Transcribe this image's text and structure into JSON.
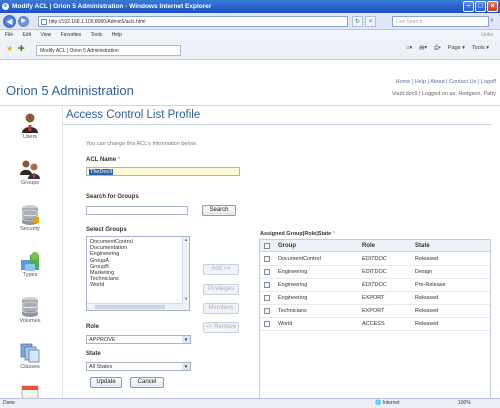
{
  "browser": {
    "title": "Modify ACL | Orion 5 Administration - Windows Internet Explorer",
    "address": "http://192.168.1.105:8080/Admin5/acls.html",
    "search_placeholder": "Live Search",
    "menu": [
      "File",
      "Edit",
      "View",
      "Favorites",
      "Tools",
      "Help"
    ],
    "links_label": "Links",
    "tab_label": "Modify ACL | Orion 5 Administration",
    "tools": [
      "Page ▾",
      "Tools ▾"
    ],
    "status_done": "Done",
    "status_zone": "Internet",
    "status_zoom": "100%"
  },
  "header": {
    "app_title": "Orion 5 Administration",
    "top_links": "Home | Help | About | Contact Us | Logoff",
    "vault_line": "Vault:doc9  |  Logged on as: Hodgson, Patty"
  },
  "sidebar": {
    "items": [
      {
        "label": "Users",
        "icon": "user-icon"
      },
      {
        "label": "Groups",
        "icon": "group-icon"
      },
      {
        "label": "Security",
        "icon": "database-lock-icon"
      },
      {
        "label": "Types",
        "icon": "types-icon"
      },
      {
        "label": "Volumes",
        "icon": "volumes-icon"
      },
      {
        "label": "Classes",
        "icon": "classes-icon"
      }
    ]
  },
  "form": {
    "page_title": "Access Control List Profile",
    "intro": "You can change this ACL's information below.",
    "acl_name_label": "ACL Name",
    "required_mark": "*",
    "acl_name_value": "TheDoc9",
    "search_groups_label": "Search for Groups",
    "search_groups_value": "",
    "search_button": "Search",
    "select_groups_label": "Select Groups",
    "groups": [
      "DocumentControl",
      "Documentation",
      "Engineering",
      "GroupA",
      "GroupB",
      "Marketing",
      "Technicians",
      "World"
    ],
    "add_button": "Add >>",
    "privileges_button": "Privileges",
    "members_button": "Members",
    "remove_button": "<< Remove",
    "role_label": "Role",
    "role_value": "APPROVE",
    "state_label": "State",
    "state_value": "All States",
    "update_button": "Update",
    "cancel_button": "Cancel"
  },
  "assigned": {
    "title": "Assigned Group|Role|State",
    "required_mark": "*",
    "columns": [
      "Group",
      "Role",
      "State"
    ],
    "rows": [
      {
        "group": "DocumentControl",
        "role": "EDITDOC",
        "state": "Released",
        "italic_role": true
      },
      {
        "group": "Engineering",
        "role": "EDITDOC",
        "state": "Design",
        "italic_role": false
      },
      {
        "group": "Engineering",
        "role": "EDITDOC",
        "state": "Pre-Release",
        "italic_role": true
      },
      {
        "group": "Engineering",
        "role": "EXPORT",
        "state": "Released",
        "italic_role": false
      },
      {
        "group": "Technicians",
        "role": "EXPORT",
        "state": "Released",
        "italic_role": false
      },
      {
        "group": "World",
        "role": "ACCESS",
        "state": "Released",
        "italic_role": false
      }
    ]
  }
}
